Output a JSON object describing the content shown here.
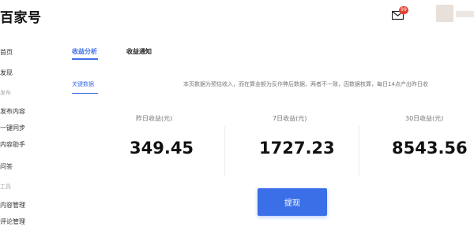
{
  "app": {
    "logo_text": "百家号",
    "notification_count": "99"
  },
  "sidebar": {
    "items": [
      {
        "label": "首页"
      },
      {
        "label": "发现"
      },
      {
        "label": "发布",
        "group": true
      },
      {
        "label": "发布内容"
      },
      {
        "label": "一键同步"
      },
      {
        "label": "内容助手"
      },
      {
        "label": "问答"
      },
      {
        "label": "工具",
        "group": true
      },
      {
        "label": "内容管理"
      },
      {
        "label": "评论管理"
      }
    ]
  },
  "tabs": {
    "income_analysis": "收益分析",
    "income_notice": "收益通知"
  },
  "subtab": {
    "key_data": "关键数据"
  },
  "notice_text": "本页数据为预估收入，而在算金额为反作弊后数据，两者不一致，因数据核算，每日14点产出昨日收",
  "stats": [
    {
      "label": "昨日收益(元)",
      "value": "349.45"
    },
    {
      "label": "7日收益(元)",
      "value": "1727.23"
    },
    {
      "label": "30日收益(元)",
      "value": "8543.56"
    }
  ],
  "withdraw_button": "提现",
  "colors": {
    "accent": "#3b6fe8",
    "badge": "#e2412f"
  }
}
